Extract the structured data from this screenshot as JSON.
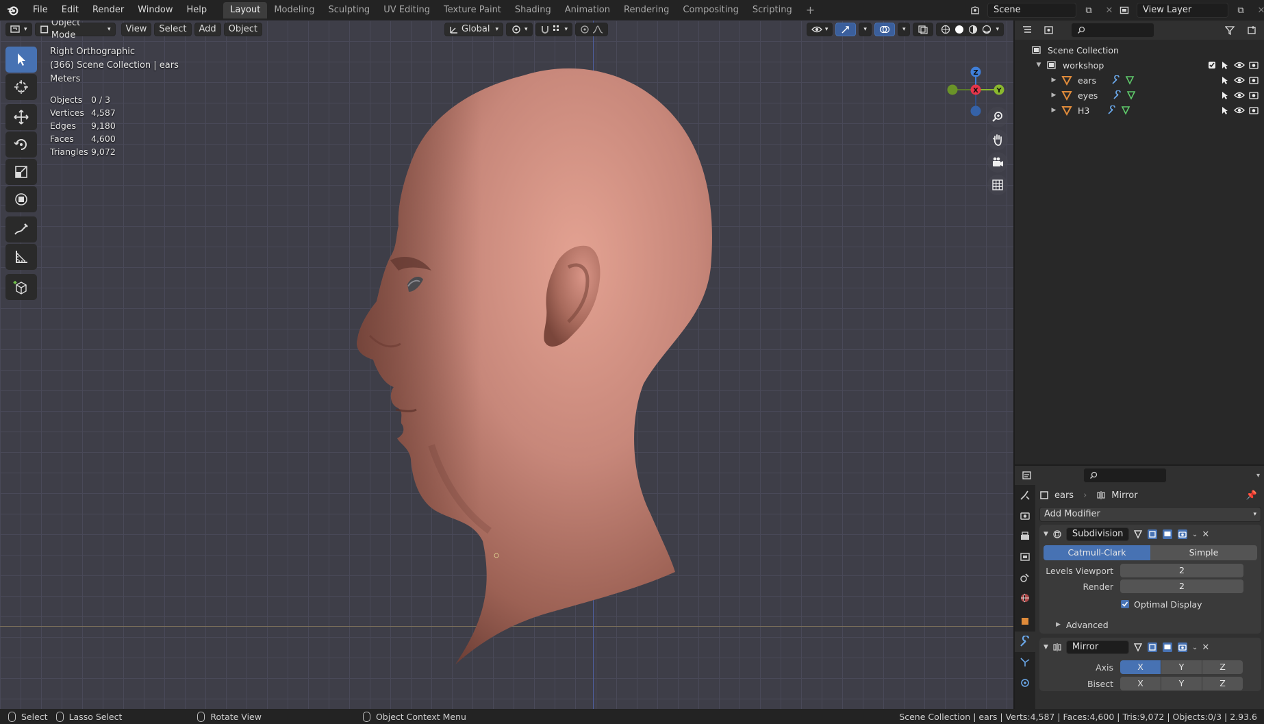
{
  "menu": [
    "File",
    "Edit",
    "Render",
    "Window",
    "Help"
  ],
  "workspaces": [
    "Layout",
    "Modeling",
    "Sculpting",
    "UV Editing",
    "Texture Paint",
    "Shading",
    "Animation",
    "Rendering",
    "Compositing",
    "Scripting"
  ],
  "active_workspace": "Layout",
  "scene_name": "Scene",
  "view_layer": "View Layer",
  "viewport": {
    "mode": "Object Mode",
    "menus": [
      "View",
      "Select",
      "Add",
      "Object"
    ],
    "orientation": "Global",
    "view_name": "Right Orthographic",
    "collection_info": "(366) Scene Collection | ears",
    "units": "Meters",
    "stats": [
      {
        "label": "Objects",
        "value": "0 / 3"
      },
      {
        "label": "Vertices",
        "value": "4,587"
      },
      {
        "label": "Edges",
        "value": "9,180"
      },
      {
        "label": "Faces",
        "value": "4,600"
      },
      {
        "label": "Triangles",
        "value": "9,072"
      }
    ],
    "gizmo": {
      "z": "Z",
      "x": "X",
      "y": "Y"
    }
  },
  "outliner": {
    "root": "Scene Collection",
    "collection": "workshop",
    "objects": [
      "ears",
      "eyes",
      "H3"
    ]
  },
  "properties": {
    "object": "ears",
    "modifier_crumb": "Mirror",
    "add_modifier": "Add Modifier",
    "subdivision": {
      "name": "Subdivision",
      "type_options": [
        "Catmull-Clark",
        "Simple"
      ],
      "levels_viewport_label": "Levels Viewport",
      "levels_viewport": "2",
      "render_label": "Render",
      "render": "2",
      "optimal_display": "Optimal Display",
      "advanced": "Advanced"
    },
    "mirror": {
      "name": "Mirror",
      "axis_label": "Axis",
      "bisect_label": "Bisect",
      "axes": [
        "X",
        "Y",
        "Z"
      ]
    }
  },
  "status": {
    "select": "Select",
    "lasso": "Lasso Select",
    "rotate": "Rotate View",
    "context": "Object Context Menu",
    "right": "Scene Collection | ears | Verts:4,587 | Faces:4,600 | Tris:9,072 | Objects:0/3 | 2.93.6"
  },
  "colors": {
    "accent": "#4772b3",
    "skin": "#b8776a",
    "x_axis": "#e8354a",
    "y_axis": "#8ab82e",
    "z_axis": "#3f7fd9"
  }
}
